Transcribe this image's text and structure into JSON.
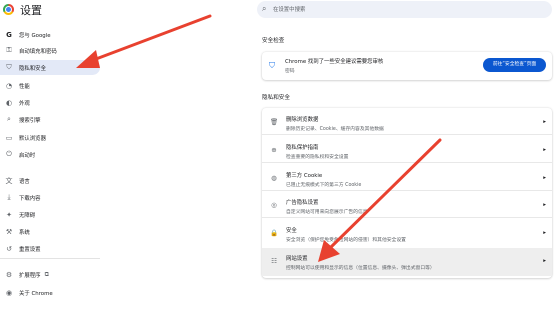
{
  "header": {
    "title": "设置",
    "search_placeholder": "在设置中搜索"
  },
  "sidebar": {
    "items": [
      {
        "icon": "google-icon",
        "glyph": "G",
        "label": "您与 Google",
        "active": false
      },
      {
        "icon": "key-icon",
        "glyph": "⚿",
        "label": "自动填充和密码",
        "active": false
      },
      {
        "icon": "shield-icon",
        "glyph": "⛉",
        "label": "隐私和安全",
        "active": true
      },
      {
        "icon": "performance-icon",
        "glyph": "◔",
        "label": "性能",
        "active": false
      },
      {
        "icon": "palette-icon",
        "glyph": "◐",
        "label": "外观",
        "active": false
      },
      {
        "icon": "search-icon",
        "glyph": "⌕",
        "label": "搜索引擎",
        "active": false
      },
      {
        "icon": "browser-icon",
        "glyph": "▭",
        "label": "默认浏览器",
        "active": false
      },
      {
        "icon": "power-icon",
        "glyph": "⏻",
        "label": "启动时",
        "active": false
      },
      {
        "icon": "translate-icon",
        "glyph": "文",
        "label": "语言",
        "active": false
      },
      {
        "icon": "download-icon",
        "glyph": "⤓",
        "label": "下载内容",
        "active": false
      },
      {
        "icon": "accessibility-icon",
        "glyph": "✦",
        "label": "无障碍",
        "active": false
      },
      {
        "icon": "wrench-icon",
        "glyph": "⚒",
        "label": "系统",
        "active": false
      },
      {
        "icon": "reset-icon",
        "glyph": "↺",
        "label": "重置设置",
        "active": false
      },
      {
        "icon": "puzzle-icon",
        "glyph": "⚙",
        "label": "扩展程序",
        "active": false
      },
      {
        "icon": "chrome-icon",
        "glyph": "◉",
        "label": "关于 Chrome",
        "active": false
      }
    ]
  },
  "safety_check": {
    "section_title": "安全检查",
    "icon": "shield-check-icon",
    "title": "Chrome 找到了一些安全建议需要您审核",
    "subtitle": "密码",
    "button_label": "前往“安全检查”页面"
  },
  "privacy": {
    "section_title": "隐私和安全",
    "rows": [
      {
        "icon": "trash-icon",
        "glyph": "🗑",
        "title": "删除浏览数据",
        "subtitle": "删除历史记录、Cookie、缓存内容及其他数据"
      },
      {
        "icon": "privacy-guide-icon",
        "glyph": "⊕",
        "title": "隐私保护指南",
        "subtitle": "检查重要的隐私权和安全设置"
      },
      {
        "icon": "cookie-icon",
        "glyph": "◍",
        "title": "第三方 Cookie",
        "subtitle": "已阻止无痕模式下的第三方 Cookie"
      },
      {
        "icon": "ad-privacy-icon",
        "glyph": "◎",
        "title": "广告隐私设置",
        "subtitle": "自定义网站可用来向您展示广告的信息"
      },
      {
        "icon": "lock-icon",
        "glyph": "🔒",
        "title": "安全",
        "subtitle": "安全浏览（保护您免受危险网站的侵害）和其他安全设置"
      },
      {
        "icon": "site-settings-icon",
        "glyph": "☷",
        "title": "网站设置",
        "subtitle": "控制网站可以使用和显示的信息（位置信息、摄像头、弹出式窗口等）"
      }
    ],
    "chevron": "▸"
  },
  "arrows": {
    "color": "#e8412f"
  }
}
